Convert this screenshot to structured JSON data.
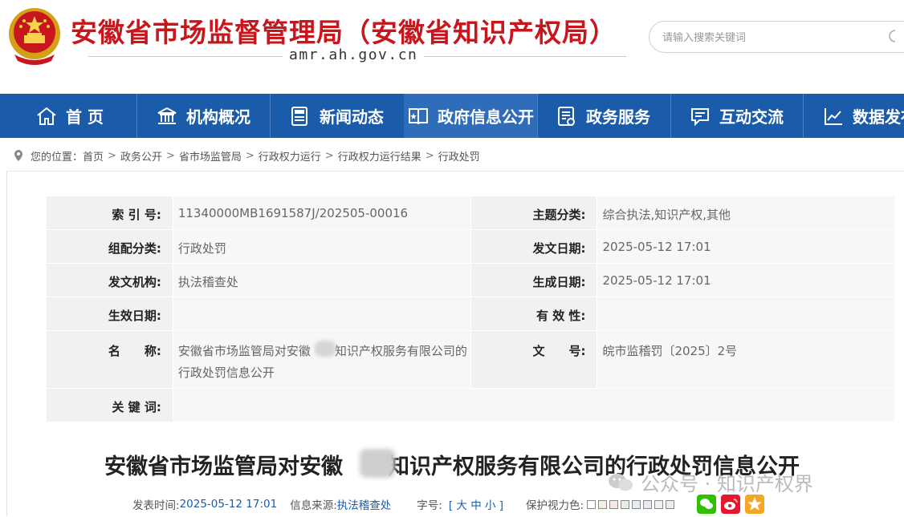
{
  "header": {
    "site_title": "安徽省市场监督管理局（安徽省知识产权局）",
    "domain": "amr.ah.gov.cn",
    "search_placeholder": "请输入搜索关键词"
  },
  "nav": [
    {
      "label": "首  页",
      "icon": "home-icon"
    },
    {
      "label": "机构概况",
      "icon": "building-icon"
    },
    {
      "label": "新闻动态",
      "icon": "news-icon"
    },
    {
      "label": "政府信息公开",
      "icon": "open-book-icon"
    },
    {
      "label": "政务服务",
      "icon": "service-doc-icon"
    },
    {
      "label": "互动交流",
      "icon": "chat-icon"
    },
    {
      "label": "数据发布",
      "icon": "chart-line-icon"
    }
  ],
  "breadcrumb": {
    "prefix": "您的位置：",
    "items": [
      "首页",
      "政务公开",
      "省市场监管局",
      "行政权力运行",
      "行政权力运行结果",
      "行政处罚"
    ]
  },
  "meta": {
    "index_label": "索 引 号:",
    "index_value": "11340000MB1691587J/202505-00016",
    "topic_label": "主题分类:",
    "topic_value": "综合执法,知识产权,其他",
    "config_label": "组配分类:",
    "config_value": "行政处罚",
    "issue_date_label": "发文日期:",
    "issue_date_value": "2025-05-12 17:01",
    "agency_label": "发文机构:",
    "agency_value": "执法稽查处",
    "created_label": "生成日期:",
    "created_value": "2025-05-12 17:01",
    "effective_label": "生效日期:",
    "effective_value": "",
    "validity_label": "有 效 性:",
    "validity_value": "",
    "name_label": "名　　称:",
    "name_value_line1": "安徽省市场监管局对安徽",
    "name_value_line1b": "知识产权服务有限公司的",
    "name_value_line2": "行政处罚信息公开",
    "docno_label": "文　　号:",
    "docno_value": "皖市监稽罚〔2025〕2号",
    "keywords_label": "关 键 词:",
    "keywords_value": ""
  },
  "article": {
    "title_part1": "安徽省市场监管局对安徽",
    "title_part2": "知识产权服务有限公司的行政处罚信息公开",
    "publish_label": "发表时间:",
    "publish_value": "2025-05-12 17:01",
    "source_label": "信息来源:",
    "source_value": "执法稽查处",
    "fontsize_label": "字号:",
    "fontsize_value": "[ 大 中 小 ]",
    "eyecare_label": "保护视力色:"
  },
  "colors": {
    "brand_red": "#c8161d",
    "nav_blue": "#1a5baa",
    "swatches": [
      "#ffffff",
      "#f5f0dc",
      "#f7e6e6",
      "#e5f0e5",
      "#e6ecf5",
      "#eee6f2",
      "#f0f0f0",
      "#ececec"
    ]
  },
  "watermark": {
    "text": "公众号 · 知识产权界"
  }
}
